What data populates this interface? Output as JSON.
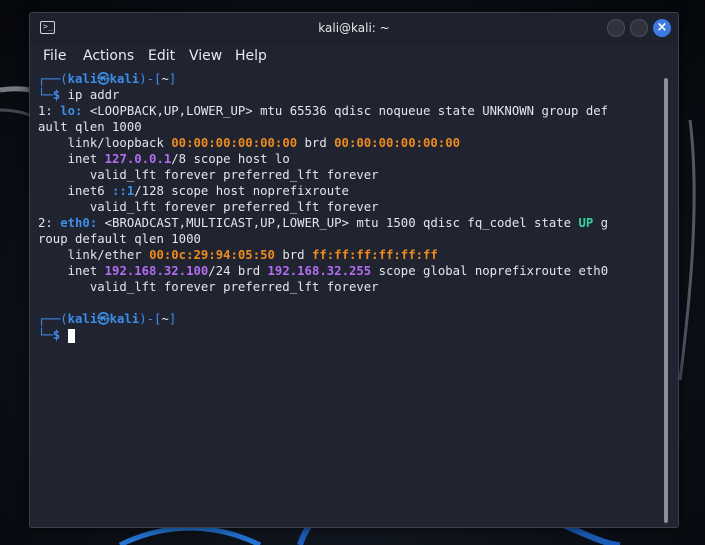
{
  "window": {
    "title": "kali@kali: ~",
    "icon": "terminal-icon"
  },
  "menu": {
    "file": "File",
    "actions": "Actions",
    "edit": "Edit",
    "view": "View",
    "help": "Help"
  },
  "prompt": {
    "top_prefix": "┌──(",
    "user": "kali",
    "at": "㉿",
    "host": "kali",
    "mid": ")-[",
    "dir": "~",
    "end": "]",
    "bottom_prefix": "└─$",
    "command": "ip addr"
  },
  "output": {
    "l1_a": "1: ",
    "l1_iface": "lo:",
    "l1_b": " <LOOPBACK,UP,LOWER_UP> mtu 65536 qdisc noqueue state UNKNOWN group def",
    "l2": "ault qlen 1000",
    "l3_a": "    link/loopback ",
    "l3_mac": "00:00:00:00:00:00",
    "l3_b": " brd ",
    "l3_brd": "00:00:00:00:00:00",
    "l4_a": "    inet ",
    "l4_ip": "127.0.0.1",
    "l4_b": "/8 scope host lo",
    "l5": "       valid_lft forever preferred_lft forever",
    "l6_a": "    inet6 ",
    "l6_ip": "::1",
    "l6_b": "/128 scope host noprefixroute",
    "l7": "       valid_lft forever preferred_lft forever",
    "l8_a": "2: ",
    "l8_iface": "eth0:",
    "l8_b": " <BROADCAST,MULTICAST,UP,LOWER_UP> mtu 1500 qdisc fq_codel state ",
    "l8_state": "UP",
    "l8_c": " g",
    "l9": "roup default qlen 1000",
    "l10_a": "    link/ether ",
    "l10_mac": "00:0c:29:94:05:50",
    "l10_b": " brd ",
    "l10_brd": "ff:ff:ff:ff:ff:ff",
    "l11_a": "    inet ",
    "l11_ip": "192.168.32.100",
    "l11_b": "/24 brd ",
    "l11_brd": "192.168.32.255",
    "l11_c": " scope global noprefixroute eth0",
    "l12": "       valid_lft forever preferred_lft forever"
  },
  "colors": {
    "prompt_blue": "#3f8de8",
    "mac_orange": "#f08a1c",
    "ip_purple": "#b46cf0",
    "state_green": "#36d4a0",
    "close_button": "#3d7be3"
  }
}
